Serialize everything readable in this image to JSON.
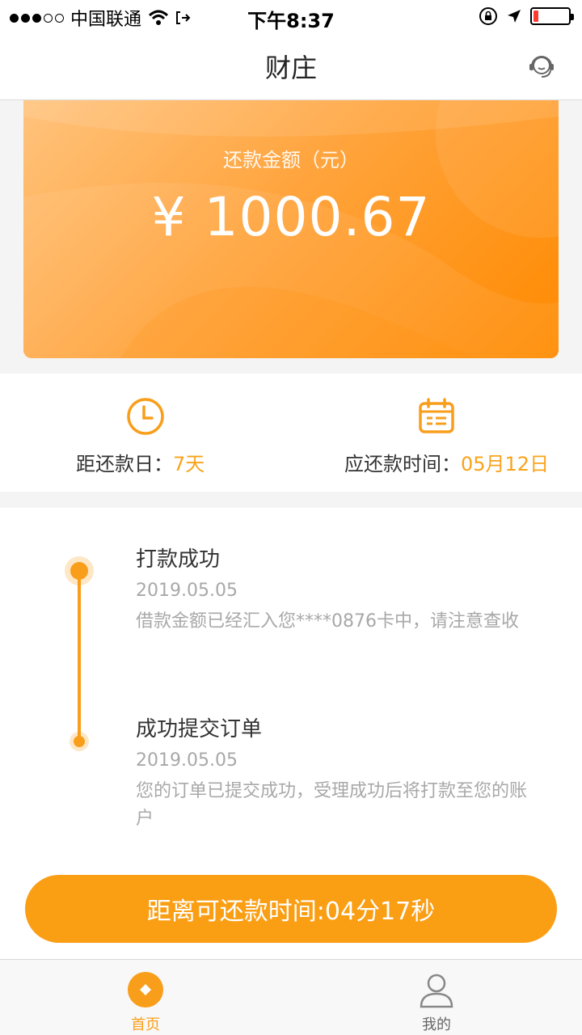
{
  "status_bar": {
    "carrier": "中国联通",
    "time": "下午8:37"
  },
  "nav": {
    "title": "财庄"
  },
  "card": {
    "label": "还款金额（元）",
    "amount": "¥ 1000.67"
  },
  "info": {
    "days_label": "距还款日：",
    "days_value": "7天",
    "date_label": "应还款时间：",
    "date_value": "05月12日"
  },
  "timeline": [
    {
      "title": "打款成功",
      "date": "2019.05.05",
      "desc": "借款金额已经汇入您****0876卡中，请注意查收"
    },
    {
      "title": "成功提交订单",
      "date": "2019.05.05",
      "desc": "您的订单已提交成功，受理成功后将打款至您的账户"
    }
  ],
  "cta_label": "距离可还款时间:04分17秒",
  "tabs": [
    {
      "label": "首页"
    },
    {
      "label": "我的"
    }
  ],
  "colors": {
    "accent": "#f99e1b",
    "card_light": "#ffc37d",
    "card_dark": "#ff8a00"
  }
}
